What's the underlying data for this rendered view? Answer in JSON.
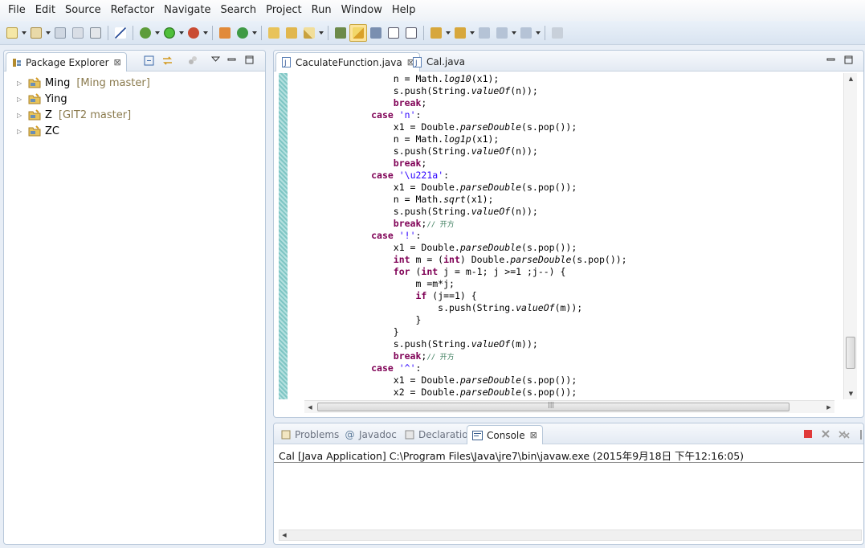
{
  "menu": [
    "File",
    "Edit",
    "Source",
    "Refactor",
    "Navigate",
    "Search",
    "Project",
    "Run",
    "Window",
    "Help"
  ],
  "package_explorer": {
    "title": "Package Explorer",
    "close_glyph": "⊠",
    "projects": [
      {
        "name": "Ming",
        "repo": "[Ming master]"
      },
      {
        "name": "Ying",
        "repo": ""
      },
      {
        "name": "Z",
        "repo": "[GIT2 master]"
      },
      {
        "name": "ZC",
        "repo": ""
      }
    ]
  },
  "editor": {
    "tabs": [
      {
        "label": "CaculateFunction.java",
        "active": true
      },
      {
        "label": "Cal.java",
        "active": false
      }
    ],
    "close_glyph": "⊠"
  },
  "code": {
    "lines": [
      [
        [
          "",
          "                n = Math."
        ],
        [
          "it",
          "log10"
        ],
        [
          "",
          "(x1);"
        ]
      ],
      [
        [
          "",
          "                s.push(String."
        ],
        [
          "it",
          "valueOf"
        ],
        [
          "",
          "(n));"
        ]
      ],
      [
        [
          "",
          "                "
        ],
        [
          "kw",
          "break"
        ],
        [
          "",
          ";"
        ]
      ],
      [
        [
          "",
          "            "
        ],
        [
          "kw",
          "case"
        ],
        [
          "",
          " "
        ],
        [
          "str",
          "'n'"
        ],
        [
          "",
          ":"
        ]
      ],
      [
        [
          "",
          "                x1 = Double."
        ],
        [
          "it",
          "parseDouble"
        ],
        [
          "",
          "(s.pop());"
        ]
      ],
      [
        [
          "",
          "                n = Math."
        ],
        [
          "it",
          "log1p"
        ],
        [
          "",
          "(x1);"
        ]
      ],
      [
        [
          "",
          "                s.push(String."
        ],
        [
          "it",
          "valueOf"
        ],
        [
          "",
          "(n));"
        ]
      ],
      [
        [
          "",
          "                "
        ],
        [
          "kw",
          "break"
        ],
        [
          "",
          ";"
        ]
      ],
      [
        [
          "",
          "            "
        ],
        [
          "kw",
          "case"
        ],
        [
          "",
          " "
        ],
        [
          "str",
          "'\\u221a'"
        ],
        [
          "",
          ":"
        ]
      ],
      [
        [
          "",
          "                x1 = Double."
        ],
        [
          "it",
          "parseDouble"
        ],
        [
          "",
          "(s.pop());"
        ]
      ],
      [
        [
          "",
          "                n = Math."
        ],
        [
          "it",
          "sqrt"
        ],
        [
          "",
          "(x1);"
        ]
      ],
      [
        [
          "",
          "                s.push(String."
        ],
        [
          "it",
          "valueOf"
        ],
        [
          "",
          "(n));"
        ]
      ],
      [
        [
          "",
          "                "
        ],
        [
          "kw",
          "break"
        ],
        [
          "",
          ";"
        ],
        [
          "cmt",
          "// 开方"
        ]
      ],
      [
        [
          "",
          "            "
        ],
        [
          "kw",
          "case"
        ],
        [
          "",
          " "
        ],
        [
          "str",
          "'!'"
        ],
        [
          "",
          ":"
        ]
      ],
      [
        [
          "",
          "                x1 = Double."
        ],
        [
          "it",
          "parseDouble"
        ],
        [
          "",
          "(s.pop());"
        ]
      ],
      [
        [
          "",
          "                "
        ],
        [
          "kw",
          "int"
        ],
        [
          "",
          " m = ("
        ],
        [
          "kw",
          "int"
        ],
        [
          "",
          ") Double."
        ],
        [
          "it",
          "parseDouble"
        ],
        [
          "",
          "(s.pop());"
        ]
      ],
      [
        [
          "",
          "                "
        ],
        [
          "kw",
          "for"
        ],
        [
          "",
          " ("
        ],
        [
          "kw",
          "int"
        ],
        [
          "",
          " j = m-1; j >=1 ;j--) {"
        ]
      ],
      [
        [
          "",
          "                    m =m*j;"
        ]
      ],
      [
        [
          "",
          "                    "
        ],
        [
          "kw",
          "if"
        ],
        [
          "",
          " (j==1) {"
        ]
      ],
      [
        [
          "",
          "                        s.push(String."
        ],
        [
          "it",
          "valueOf"
        ],
        [
          "",
          "(m));"
        ]
      ],
      [
        [
          "",
          "                    }"
        ]
      ],
      [
        [
          "",
          "                }"
        ]
      ],
      [
        [
          "",
          "                s.push(String."
        ],
        [
          "it",
          "valueOf"
        ],
        [
          "",
          "(m));"
        ]
      ],
      [
        [
          "",
          "                "
        ],
        [
          "kw",
          "break"
        ],
        [
          "",
          ";"
        ],
        [
          "cmt",
          "// 开方"
        ]
      ],
      [
        [
          "",
          "            "
        ],
        [
          "kw",
          "case"
        ],
        [
          "",
          " "
        ],
        [
          "str",
          "'^'"
        ],
        [
          "",
          ":"
        ]
      ],
      [
        [
          "",
          "                x1 = Double."
        ],
        [
          "it",
          "parseDouble"
        ],
        [
          "",
          "(s.pop());"
        ]
      ],
      [
        [
          "",
          "                x2 = Double."
        ],
        [
          "it",
          "parseDouble"
        ],
        [
          "",
          "(s.pop());"
        ]
      ]
    ]
  },
  "bottom": {
    "tabs": [
      {
        "label": "Problems",
        "icon": "problems-icon",
        "active": false
      },
      {
        "label": "Javadoc",
        "icon": "javadoc-icon",
        "active": false
      },
      {
        "label": "Declaration",
        "icon": "declaration-icon",
        "active": false
      },
      {
        "label": "Console",
        "icon": "console-icon",
        "active": true
      }
    ],
    "javadoc_glyph": "@",
    "console_text": "Cal [Java Application] C:\\Program Files\\Java\\jre7\\bin\\javaw.exe (2015年9月18日 下午12:16:05)",
    "hscroll_glyph": "|||"
  },
  "colors": {
    "keyword": "#7f0055",
    "string": "#2a00ff",
    "comment": "#3f7f5f",
    "gutter": "#7fc6c4"
  }
}
